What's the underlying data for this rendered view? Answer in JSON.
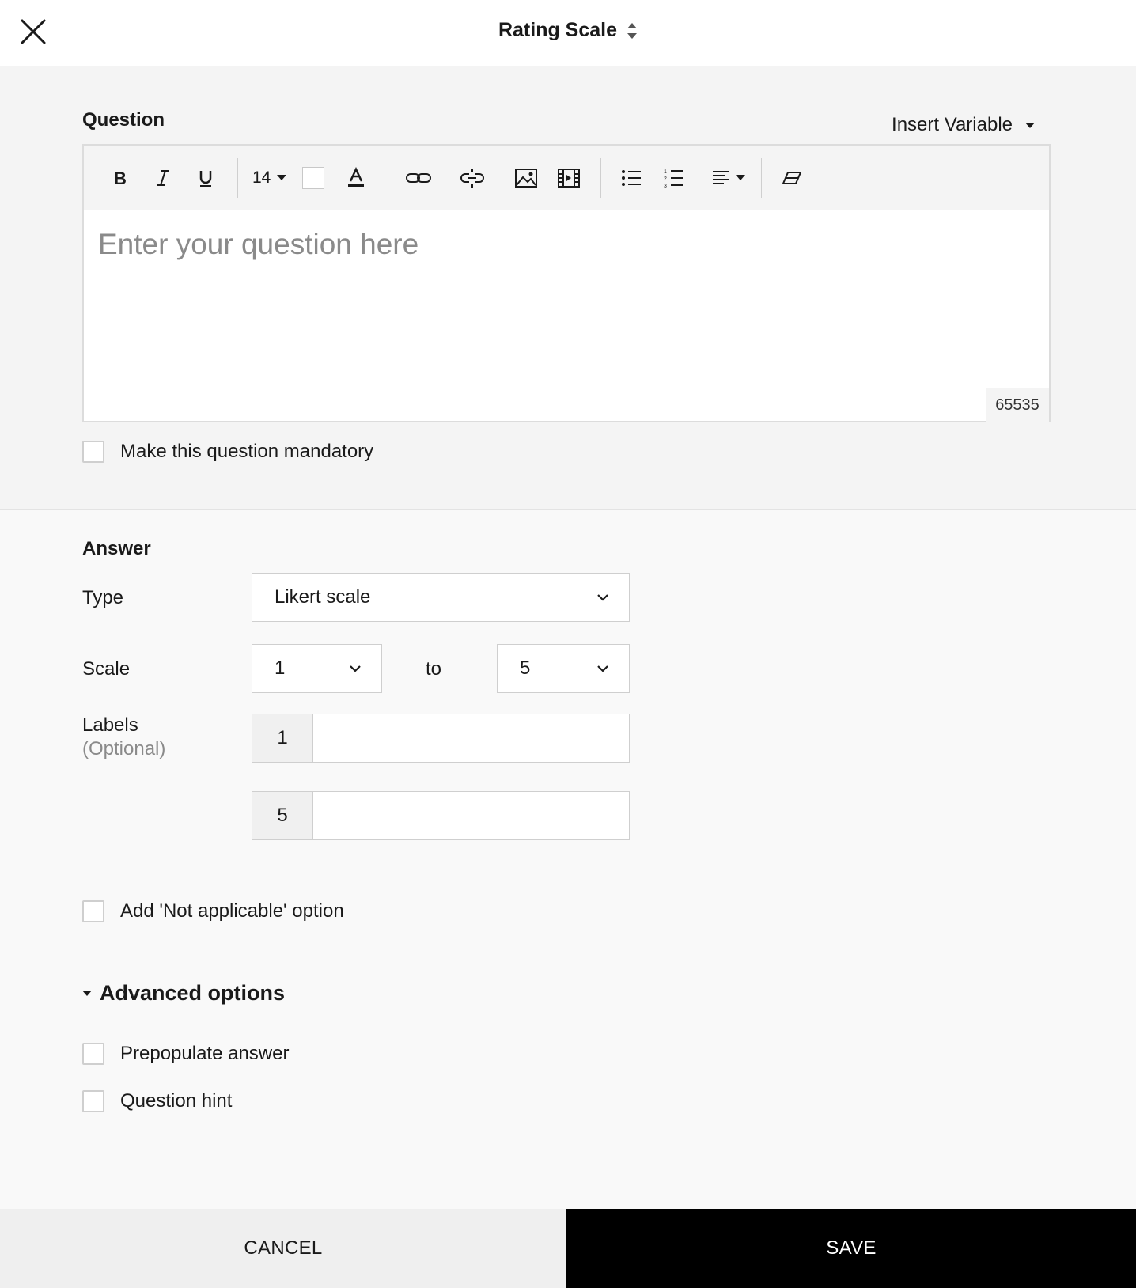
{
  "header": {
    "title": "Rating Scale",
    "close_icon": "close-icon",
    "sort_icon": "sort-arrows-icon"
  },
  "question": {
    "section_label": "Question",
    "insert_variable": "Insert Variable",
    "toolbar": {
      "font_size": "14",
      "icons": [
        "bold-icon",
        "italic-icon",
        "underline-icon",
        "font-size-dropdown",
        "background-color-box",
        "text-color-icon",
        "link-icon",
        "unlink-icon",
        "image-icon",
        "video-icon",
        "bullet-list-icon",
        "numbered-list-icon",
        "align-icon",
        "eraser-icon"
      ]
    },
    "placeholder": "Enter your question here",
    "char_count": "65535",
    "mandatory_label": "Make this question mandatory"
  },
  "answer": {
    "section_label": "Answer",
    "type_label": "Type",
    "type_value": "Likert scale",
    "scale_label": "Scale",
    "scale_from": "1",
    "scale_to_text": "to",
    "scale_to": "5",
    "labels_label": "Labels",
    "labels_sublabel": "(Optional)",
    "label_rows": [
      {
        "prefix": "1",
        "value": ""
      },
      {
        "prefix": "5",
        "value": ""
      }
    ],
    "not_applicable_label": "Add 'Not applicable' option"
  },
  "advanced": {
    "title": "Advanced options",
    "prepopulate_label": "Prepopulate answer",
    "hint_label": "Question hint"
  },
  "footer": {
    "cancel_label": "CANCEL",
    "save_label": "SAVE"
  }
}
